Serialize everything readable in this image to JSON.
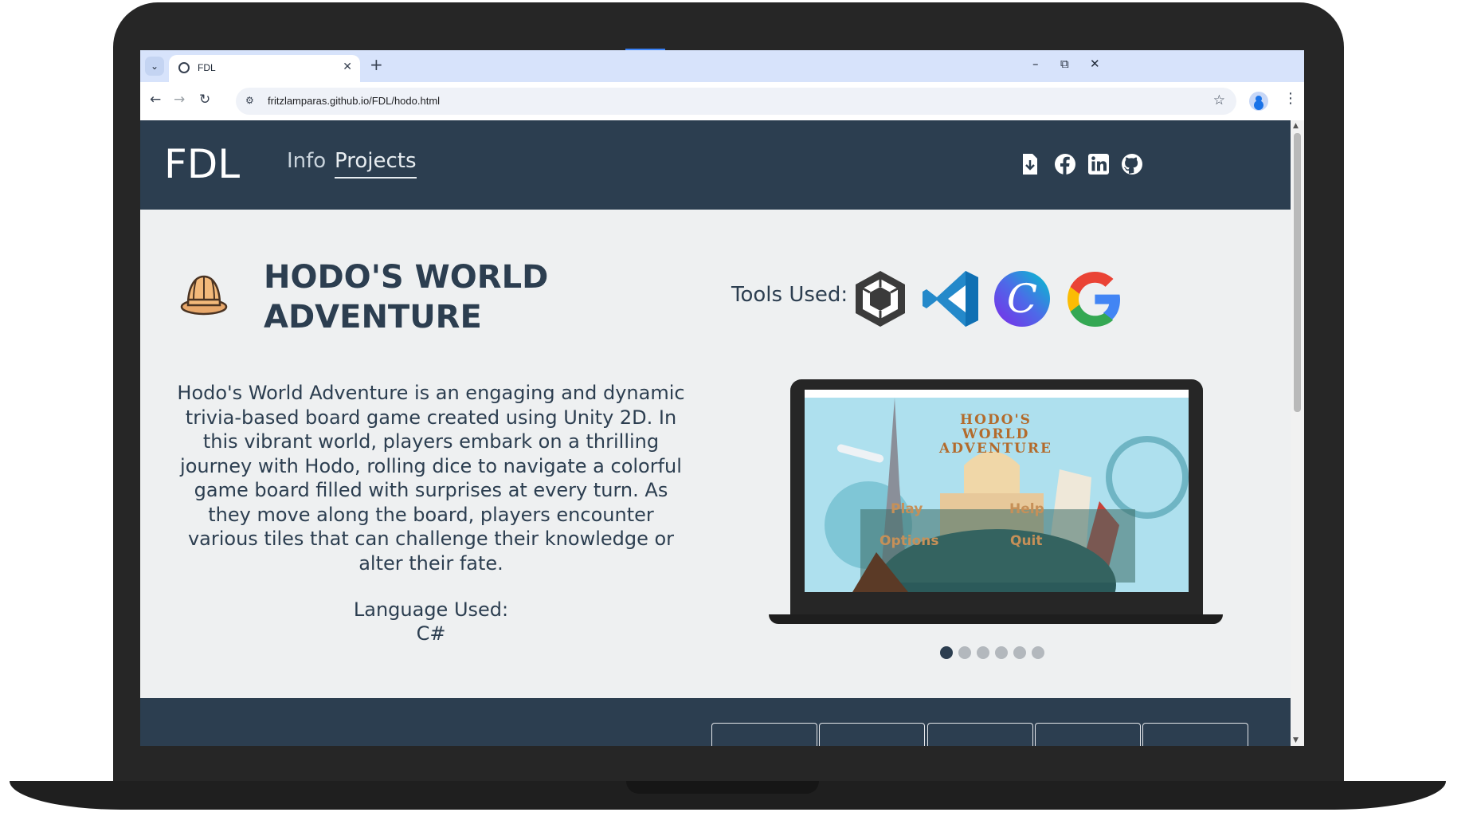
{
  "browser": {
    "tab_title": "FDL",
    "url": "fritzlamparas.github.io/FDL/hodo.html",
    "icons": [
      "tab-list-icon",
      "globe-icon",
      "close-icon",
      "plus-icon",
      "minimize-icon",
      "restore-icon",
      "close-window-icon",
      "back-icon",
      "forward-icon",
      "reload-icon",
      "site-info-icon",
      "star-icon",
      "profile-icon",
      "menu-icon"
    ]
  },
  "site": {
    "logo": "FDL",
    "nav": [
      {
        "label": "Info"
      },
      {
        "label": "Projects"
      }
    ],
    "social_icons": [
      "download-resume-icon",
      "facebook-icon",
      "linkedin-icon",
      "github-icon"
    ]
  },
  "project": {
    "icon": "explorer-hat-icon",
    "title": "HODO'S WORLD ADVENTURE",
    "tools_label": "Tools Used:",
    "tools": [
      "unity-icon",
      "vscode-icon",
      "canva-icon",
      "google-icon"
    ],
    "description": "Hodo's World Adventure is an engaging and dynamic trivia-based board game created using Unity 2D. In this vibrant world, players embark on a thrilling journey with Hodo, rolling dice to navigate a colorful game board filled with surprises at every turn. As they move along the board, players encounter various tiles that can challenge their knowledge or alter their fate.",
    "language_label": "Language Used:",
    "language": "C#"
  },
  "screenshot": {
    "window_title": "Hodo's World Adventure",
    "game_title_lines": [
      "HODO'S",
      "WORLD",
      "ADVENTURE"
    ],
    "menu": {
      "play": "Play",
      "help": "Help",
      "options": "Options",
      "quit": "Quit"
    }
  },
  "carousel": {
    "count": 6,
    "active": 0
  },
  "colors": {
    "header": "#2c3e50",
    "page_bg": "#eef0f1",
    "text": "#2c3e50",
    "tab_strip": "#d7e3fb"
  }
}
